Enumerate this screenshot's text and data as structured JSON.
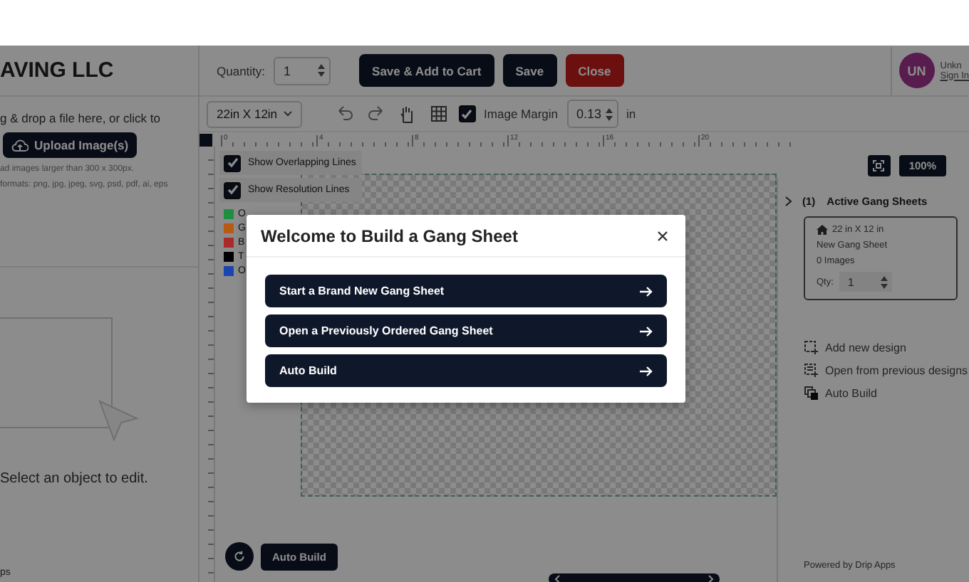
{
  "left_panel": {
    "company": "AVING LLC",
    "upload_hint": "g & drop a file here, or click to",
    "upload_button": "Upload Image(s)",
    "notes": [
      "ad images larger than 300 x 300px.",
      "formats: png, jpg, jpeg, svg, psd, pdf, ai, eps"
    ],
    "empty_state": "Select an object to edit.",
    "footer": "ps"
  },
  "header": {
    "quantity_label": "Quantity:",
    "quantity": "1",
    "buttons": [
      {
        "label": "Save & Add to Cart",
        "kind": "primary"
      },
      {
        "label": "Save",
        "kind": "primary"
      },
      {
        "label": "Close",
        "kind": "danger"
      }
    ],
    "user": {
      "initials": "UN",
      "name": "Unkn",
      "link": "Sign In"
    }
  },
  "toolbar": {
    "size": "22in X 12in",
    "image_margin": {
      "label": "Image Margin",
      "checked": true,
      "value": "0.13",
      "unit": "in"
    }
  },
  "ruler": {
    "ticks": [
      "0",
      "4",
      "8",
      "12",
      "16",
      "20"
    ]
  },
  "canvas": {
    "options": [
      {
        "label": "Show Overlapping Lines",
        "checked": true
      },
      {
        "label": "Show Resolution Lines",
        "checked": true
      }
    ],
    "legend": [
      {
        "label": "O",
        "color": "#1f8f3f"
      },
      {
        "label": "G",
        "color": "#b85a14"
      },
      {
        "label": "B",
        "color": "#a82a2a"
      },
      {
        "label": "T",
        "color": "#000000"
      },
      {
        "label": "O",
        "color": "#1a44b0"
      }
    ],
    "zoom": "100%",
    "auto_build": "Auto Build"
  },
  "right_panel": {
    "count": "(1)",
    "title": "Active Gang Sheets",
    "sheet": {
      "size": "22 in X 12 in",
      "name": "New Gang Sheet",
      "images": "0 Images",
      "qty_label": "Qty:",
      "qty": "1"
    },
    "actions": [
      {
        "label": "Add new design",
        "kind": "add"
      },
      {
        "label": "Open from previous designs",
        "kind": "open"
      },
      {
        "label": "Auto Build",
        "kind": "auto"
      }
    ],
    "footer": "Powered by Drip Apps"
  },
  "modal": {
    "title": "Welcome to Build a Gang Sheet",
    "options": [
      "Start a Brand New Gang Sheet",
      "Open a Previously Ordered Gang Sheet",
      "Auto Build"
    ]
  }
}
